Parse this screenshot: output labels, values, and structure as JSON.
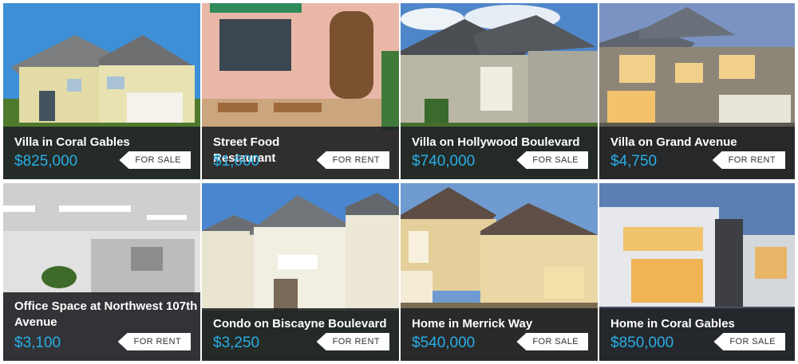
{
  "listings": [
    {
      "title": "Villa in Coral Gables",
      "price": "$825,000",
      "badge": "FOR SALE"
    },
    {
      "title": "Street Food Restaurant",
      "price": "$1,600",
      "badge": "FOR RENT"
    },
    {
      "title": "Villa on Hollywood Boulevard",
      "price": "$740,000",
      "badge": "FOR SALE"
    },
    {
      "title": "Villa on Grand Avenue",
      "price": "$4,750",
      "badge": "FOR RENT"
    },
    {
      "title": "Office Space at Northwest 107th Avenue",
      "price": "$3,100",
      "badge": "FOR RENT"
    },
    {
      "title": "Condo on Biscayne Boulevard",
      "price": "$3,250",
      "badge": "FOR RENT"
    },
    {
      "title": "Home in Merrick Way",
      "price": "$540,000",
      "badge": "FOR SALE"
    },
    {
      "title": "Home in Coral Gables",
      "price": "$850,000",
      "badge": "FOR SALE"
    }
  ],
  "colors": {
    "overlay": "#202226",
    "price": "#29aee6",
    "badge_bg": "#ffffff",
    "badge_text": "#333333"
  }
}
